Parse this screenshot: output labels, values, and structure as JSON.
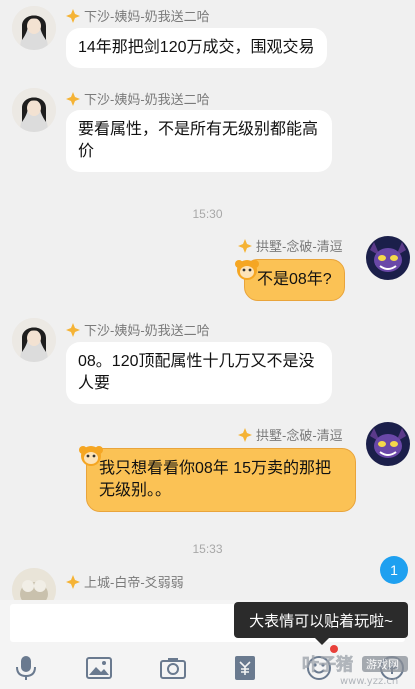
{
  "messages": [
    {
      "sender": "下沙-姨妈-奶我送二哈",
      "text": "14年那把剑120万成交，围观交易"
    },
    {
      "sender": "下沙-姨妈-奶我送二哈",
      "text_line1": "要看属性，不是所有无级别都能高",
      "text_line2": "价"
    },
    {
      "sender": "拱墅-念破-清逗",
      "text": "不是08年?"
    },
    {
      "sender": "下沙-姨妈-奶我送二哈",
      "text_line1": "08。120顶配属性十几万又不是没",
      "text_line2": "人要"
    },
    {
      "sender": "拱墅-念破-清逗",
      "text_line1": "我只想看看你08年  15万卖的那把",
      "text_line2": "无级别。。"
    },
    {
      "sender": "上城-白帝-爻弱弱"
    }
  ],
  "timestamps": [
    "15:30",
    "15:33"
  ],
  "unread_badge": "1",
  "tooltip": "大表情可以贴着玩啦~",
  "toolbar": {
    "icons": [
      "microphone-icon",
      "image-icon",
      "camera-icon",
      "red-packet-icon",
      "emoji-icon",
      "plus-icon"
    ]
  },
  "watermark": {
    "brand": "叶子猪",
    "sub": "游戏网",
    "url": "www.yzz.cn"
  },
  "colors": {
    "background": "#f0f0f0",
    "own_bubble": "#fbc255",
    "other_bubble": "#ffffff",
    "badge": "#1ea0f0",
    "tooltip": "#2b2b2b"
  }
}
